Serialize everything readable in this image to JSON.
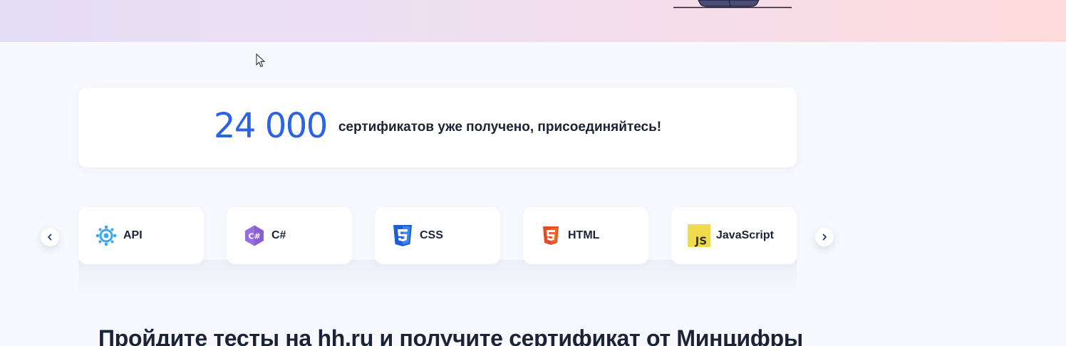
{
  "colors": {
    "accent": "#2b63e6",
    "text_primary": "#1c2336",
    "page_background": "#f8f9fe",
    "card_background": "#ffffff"
  },
  "stats": {
    "number": "24 000",
    "caption": "сертификатов уже получено, присоединяйтесь!"
  },
  "carousel": {
    "prev_icon": "chevron-left-icon",
    "next_icon": "chevron-right-icon",
    "items": [
      {
        "label": "API",
        "icon": "api-icon"
      },
      {
        "label": "C#",
        "icon": "csharp-icon"
      },
      {
        "label": "CSS",
        "icon": "css3-icon"
      },
      {
        "label": "HTML",
        "icon": "html5-icon"
      },
      {
        "label": "JavaScript",
        "icon": "javascript-icon"
      }
    ]
  },
  "section": {
    "title": "Пройдите тесты на hh.ru и получите сертификат от Минцифры"
  }
}
